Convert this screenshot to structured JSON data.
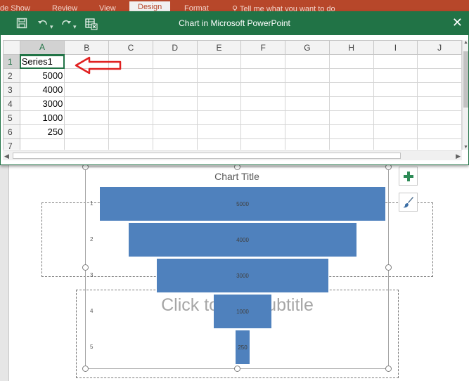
{
  "ribbon": {
    "tabs": [
      "de Show",
      "Review",
      "View",
      "Design",
      "Format"
    ],
    "tell_me": "Tell me what you want to do"
  },
  "window": {
    "title": "Chart in Microsoft PowerPoint",
    "close_glyph": "✕"
  },
  "sheet": {
    "columns": [
      "A",
      "B",
      "C",
      "D",
      "E",
      "F",
      "G",
      "H",
      "I",
      "J"
    ],
    "rows": [
      "1",
      "2",
      "3",
      "4",
      "5",
      "6",
      "7"
    ],
    "cells": {
      "A1": "Series1",
      "A2": "5000",
      "A3": "4000",
      "A4": "3000",
      "A5": "1000",
      "A6": "250"
    },
    "active_cell": "A1"
  },
  "slide": {
    "subtitle_placeholder": "Click to add subtitle"
  },
  "chart_data": {
    "type": "bar",
    "subtype": "funnel",
    "title": "Chart Title",
    "categories": [
      "1",
      "2",
      "3",
      "4",
      "5"
    ],
    "values": [
      5000,
      4000,
      3000,
      1000,
      250
    ],
    "data_labels": [
      "5000",
      "4000",
      "3000",
      "1000",
      "250"
    ],
    "bar_color": "#4f81bd"
  },
  "colors": {
    "excel_green": "#217346",
    "annotation_red": "#e02020",
    "ribbon_red": "#b7472a"
  },
  "icons": {
    "save": "save-icon",
    "undo": "undo-icon",
    "redo": "redo-icon",
    "edit_data": "edit-data-in-excel-icon",
    "chart_elements": "plus-icon",
    "chart_styles": "paintbrush-icon"
  }
}
